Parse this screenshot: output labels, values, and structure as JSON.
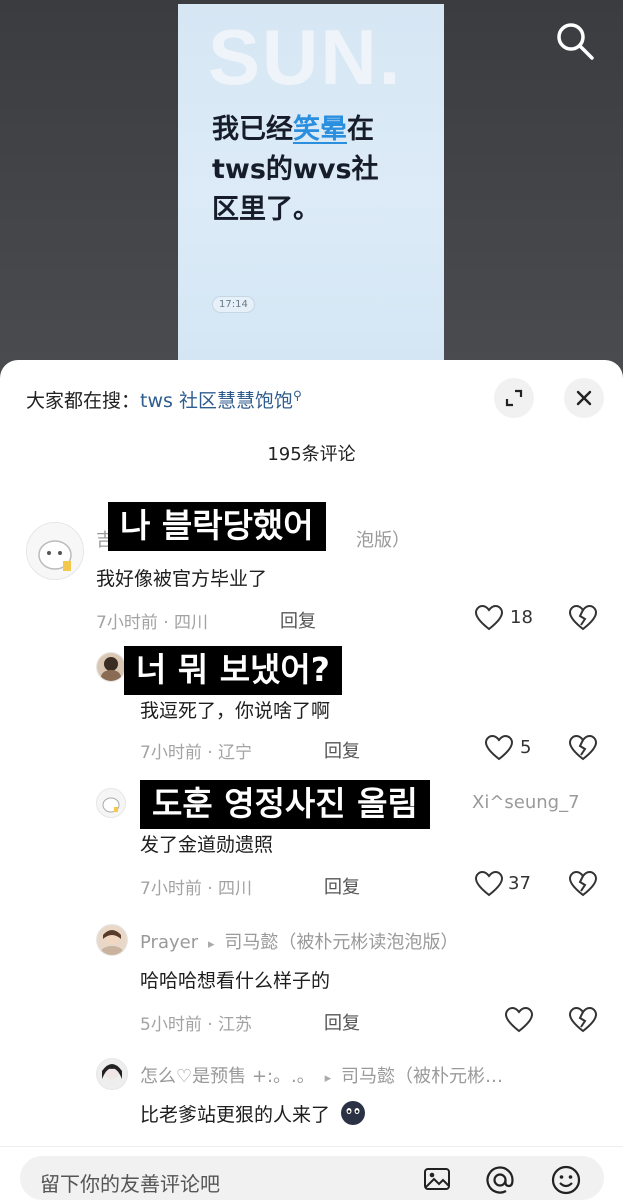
{
  "video": {
    "brand": "SUN.",
    "caption_line1_a": "我已经",
    "caption_line1_hl": "笑晕",
    "caption_line1_b": "在",
    "caption_line2": "tws的wvs社",
    "caption_line3": "区里了。",
    "time": "17:14"
  },
  "panel": {
    "suggest_prefix": "大家都在搜：",
    "suggest_query": "tws 社区慧慧饱饱",
    "comment_count": "195条评论"
  },
  "comments": [
    {
      "name": "司马懿（被朴元彬读泡泡版）",
      "name_visible": "吉",
      "name_tail": "泡版）",
      "text": "我好像被官方毕业了",
      "meta": "7小时前 · 四川",
      "reply": "回复",
      "likes": "18",
      "subtitle": "나 블락당했어"
    },
    {
      "text": "我逗死了，你说啥了啊",
      "meta": "7小时前 · 辽宁",
      "reply": "回复",
      "likes": "5",
      "subtitle": "너 뭐 보냈어?"
    },
    {
      "name_tail": "Xi^seung_7",
      "text": "发了金道勋遗照",
      "meta": "7小时前 · 四川",
      "reply": "回复",
      "likes": "37",
      "subtitle": "도훈 영정사진 올림"
    },
    {
      "name": "Prayer",
      "reply_to": "司马懿（被朴元彬读泡泡版）",
      "text": "哈哈哈想看什么样子的",
      "meta": "5小时前 · 江苏",
      "reply": "回复"
    },
    {
      "name": "怎么♡是预售 +:。.。",
      "reply_to": "司马懿（被朴元彬…",
      "text": "比老爹站更狠的人来了"
    }
  ],
  "input": {
    "placeholder": "留下你的友善评论吧"
  },
  "icons": [
    "search-icon",
    "expand-icon",
    "close-icon",
    "heart-icon",
    "broken-heart-icon",
    "image-icon",
    "at-icon",
    "emoji-icon"
  ]
}
